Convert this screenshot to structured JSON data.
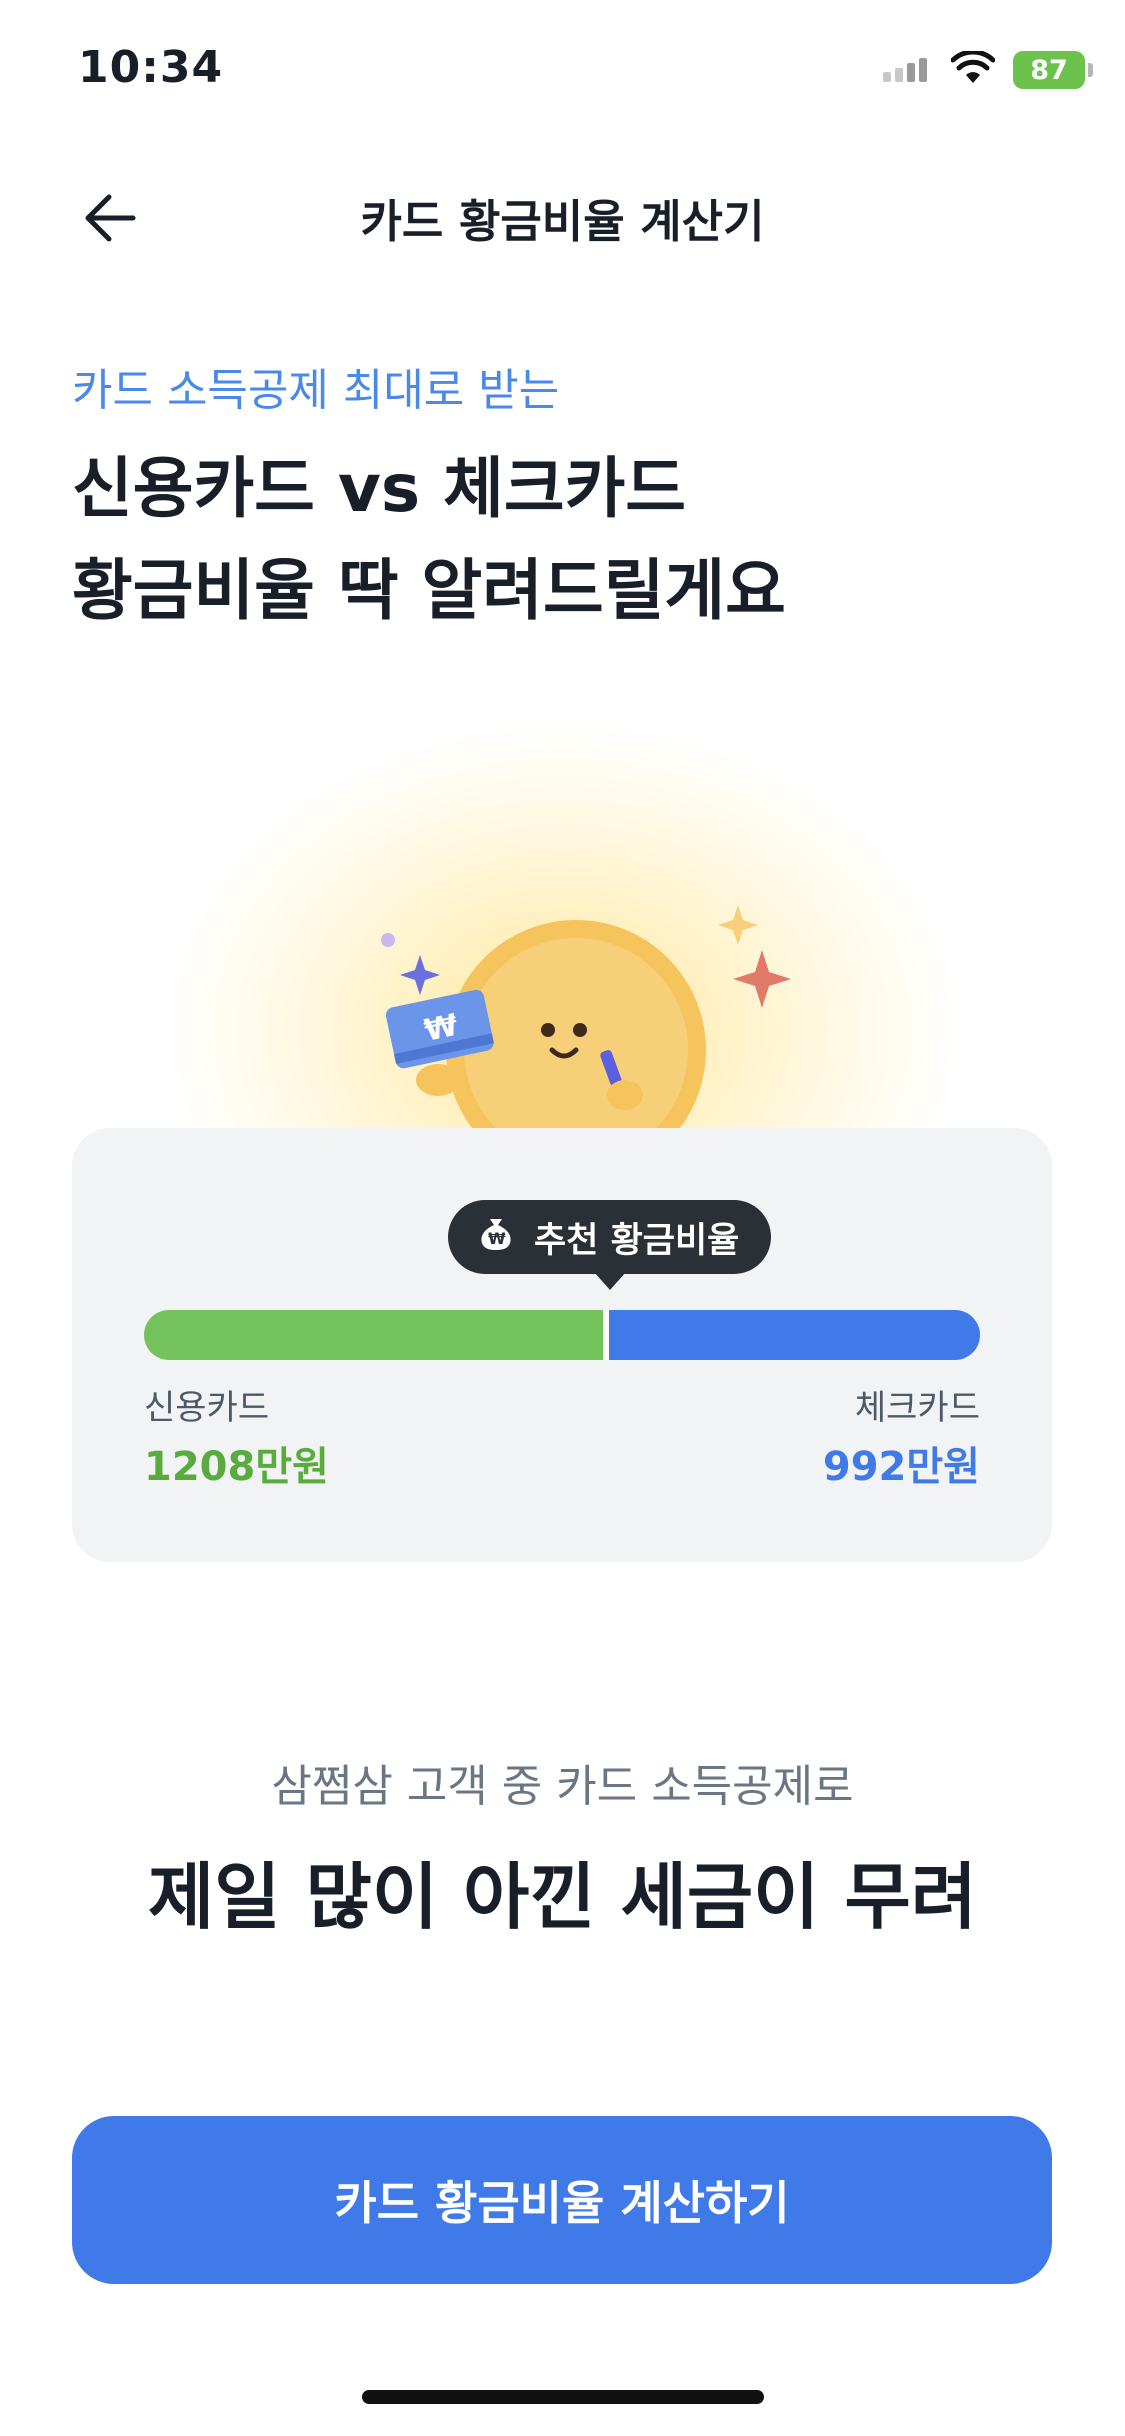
{
  "status_bar": {
    "time": "10:34",
    "battery": "87"
  },
  "nav": {
    "title": "카드 황금비율 계산기",
    "back_icon": "arrow-left-icon"
  },
  "hero": {
    "subtitle": "카드 소득공제 최대로 받는",
    "headline_line1": "신용카드 vs 체크카드",
    "headline_line2": "황금비율 딱 알려드릴게요"
  },
  "ratio_card": {
    "tooltip": "추천 황금비율",
    "credit_label": "신용카드",
    "credit_value": "1208만원",
    "check_label": "체크카드",
    "check_value": "992만원",
    "credit_share": 0.549
  },
  "bottom": {
    "caption": "삼쩜삼 고객 중 카드 소득공제로",
    "big_text": "제일 많이 아낀 세금이 무려"
  },
  "cta": {
    "label": "카드 황금비율 계산하기"
  },
  "colors": {
    "accent": "#3f7ae8",
    "credit": "#73c25c",
    "subtitle": "#4a89e8"
  }
}
